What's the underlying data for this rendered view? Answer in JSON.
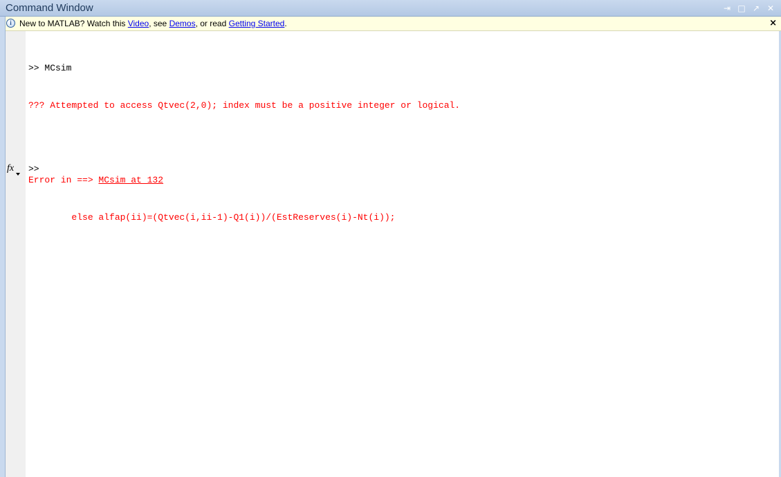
{
  "window": {
    "title": "Command Window",
    "controls": [
      "⇥",
      "□",
      "↗",
      "✕"
    ]
  },
  "infobar": {
    "prefix": "New to MATLAB? Watch this ",
    "video_link": "Video",
    "mid1": ", see ",
    "demos_link": "Demos",
    "mid2": ", or read ",
    "getting_started_link": "Getting Started",
    "suffix": ".",
    "close": "×",
    "icon_glyph": "i"
  },
  "console": {
    "line1": ">> MCsim",
    "line2": "??? Attempted to access Qtvec(2,0); index must be a positive integer or logical.",
    "error_prefix": "Error in ==> ",
    "error_link": "MCsim at 132",
    "line5": "        else alfap(ii)=(Qtvec(i,ii-1)-Q1(i))/(EstReserves(i)-Nt(i));",
    "prompt": ">>",
    "fx_label": "fx"
  },
  "colors": {
    "error": "#ff0000",
    "link": "#0000ee",
    "infobar_bg": "#ffffe1",
    "titlebar_bg": "#b3c8e4"
  }
}
